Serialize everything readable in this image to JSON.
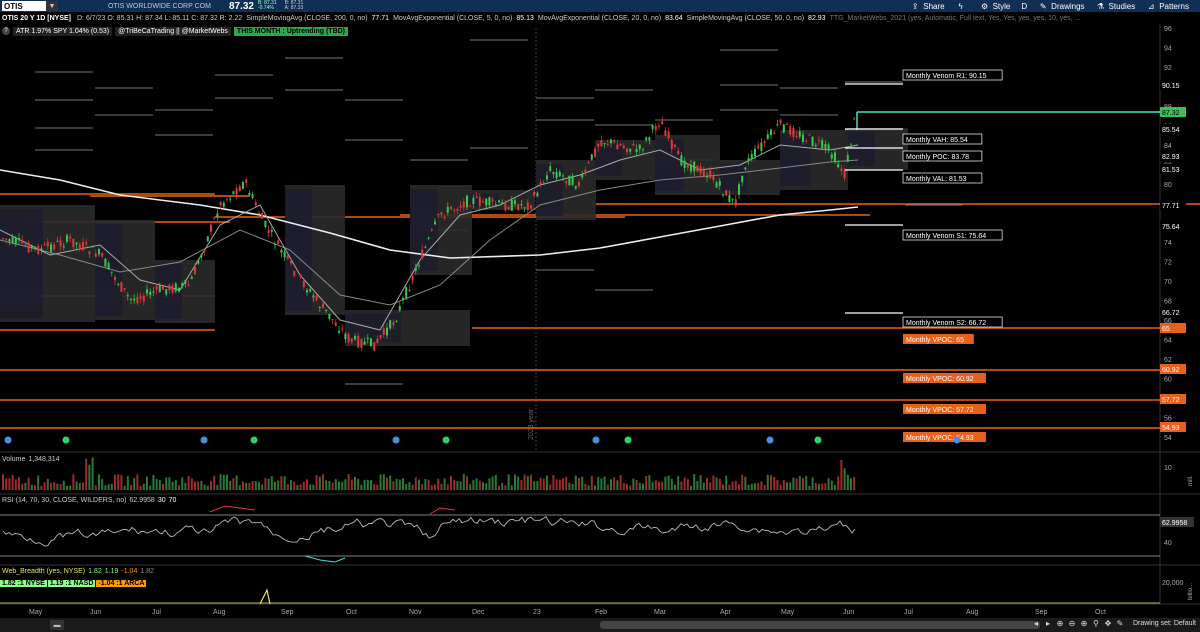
{
  "topbar": {
    "symbol": "OTIS",
    "company": "OTIS WORLDWIDE CORP COM",
    "last": "87.32",
    "bid_top": "B: 87.31",
    "bid_bot": "-0.74%",
    "ask_top": "B: 87.31",
    "ask_bot": "A: 87.33",
    "buttons": [
      {
        "label": "Share",
        "icon": "share-icon"
      },
      {
        "label": "",
        "icon": "lightning-icon"
      },
      {
        "label": "Style",
        "icon": "style-icon"
      },
      {
        "label": "D",
        "icon": "period-icon"
      },
      {
        "label": "Drawings",
        "icon": "drawings-icon"
      },
      {
        "label": "Studies",
        "icon": "flask-icon"
      },
      {
        "label": "Patterns",
        "icon": "patterns-icon"
      }
    ]
  },
  "studybar": {
    "symbol": "OTIS 20 Y 1D [NYSE]",
    "ohlc": "D: 6/7/23   O: 85.31   H: 87.34   L: 85.11   C: 87.32   R: 2.22",
    "sma200": "SimpleMovingAvg (CLOSE, 200, 0, no)",
    "sma200_val": "77.71",
    "ema5": "MovAvgExponential (CLOSE, 5, 0, no)",
    "ema5_val": "85.13",
    "ema20": "MovAvgExponential (CLOSE, 20, 0, no)",
    "ema20_val": "83.64",
    "sma50": "SimpleMovingAvg (CLOSE, 50, 0, no)",
    "sma50_val": "82.93",
    "ttg": "TTG_MarketWebs_2021 (yes, Automatic, Full text, Yes, Yes, yes, yes, 10, yes, ..."
  },
  "row2": {
    "atr": "ATR 1.97% SPY 1.04% (0.53)",
    "handles": "@TriBeCaTrading || @MarketWebs",
    "status": "THIS MONTH : Uptrending (TBD)"
  },
  "price_axis": [
    "96",
    "94",
    "92",
    "90",
    "88",
    "86",
    "84",
    "82",
    "80",
    "78",
    "76",
    "74",
    "72",
    "70",
    "68",
    "66",
    "64",
    "62",
    "60",
    "58",
    "56",
    "54"
  ],
  "price_labels": [
    {
      "text": "90.15",
      "color": "#ffffff",
      "bg": "#000000"
    },
    {
      "text": "87.32",
      "color": "#000000",
      "bg": "#3fbf5a"
    },
    {
      "text": "85.54",
      "color": "#ffffff",
      "bg": "#000000"
    },
    {
      "text": "82.93",
      "color": "#ffffff",
      "bg": "#000000"
    },
    {
      "text": "81.53",
      "color": "#ffffff",
      "bg": "#000000"
    },
    {
      "text": "77.71",
      "color": "#ffffff",
      "bg": "#000000"
    },
    {
      "text": "75.64",
      "color": "#ffffff",
      "bg": "#000000"
    },
    {
      "text": "66.72",
      "color": "#ffffff",
      "bg": "#000000"
    },
    {
      "text": "65",
      "color": "#ffffff",
      "bg": "#e8601a"
    },
    {
      "text": "60.92",
      "color": "#ffffff",
      "bg": "#e8601a"
    },
    {
      "text": "57.72",
      "color": "#ffffff",
      "bg": "#e8601a"
    },
    {
      "text": "54.93",
      "color": "#ffffff",
      "bg": "#e8601a"
    }
  ],
  "annotations": [
    {
      "text": "Monthly Venom R1: 90.15"
    },
    {
      "text": "Monthly VAH: 85.54"
    },
    {
      "text": "Monthly POC: 83.78"
    },
    {
      "text": "Monthly VAL: 81.53"
    },
    {
      "text": "Monthly Venom S1: 75.64"
    },
    {
      "text": "Monthly Venom S2: 66.72"
    },
    {
      "text": "Monthly VPOC: 65"
    },
    {
      "text": "Monthly VPOC: 60.92"
    },
    {
      "text": "Monthly VPOC: 57.72"
    },
    {
      "text": "Monthly VPOC: 54.93"
    }
  ],
  "year_marker": "2023 year",
  "volume": {
    "title": "Volume",
    "value": "1,348,314",
    "axis_top": "10",
    "axis_unit": "mill."
  },
  "rsi": {
    "title": "RSI (14, 70, 30, CLOSE, WILDERS, no)",
    "value": "62.9958",
    "ob": "30",
    "os": "70",
    "axis": [
      "60",
      "40"
    ],
    "label": "62.9958"
  },
  "breadth": {
    "title": "Web_Breadth (yes, NYSE)",
    "vals": [
      "1.82",
      "1.19",
      "-1.04",
      "1.82"
    ],
    "nyse": "1.82 :1 NYSE",
    "nasd": "1.19 :1 NASD",
    "arca": "-1.04 :1 ARCA",
    "axis_top": "20,000",
    "axis_unit": "billio..."
  },
  "months": [
    "May",
    "Jun",
    "Jul",
    "Aug",
    "Sep",
    "Oct",
    "Nov",
    "Dec",
    "23",
    "Feb",
    "Mar",
    "Apr",
    "May",
    "Jun",
    "Jul",
    "Aug",
    "Sep",
    "Oct"
  ],
  "bottom": {
    "drawing_set": "Drawing set: Default"
  },
  "colors": {
    "up": "#3cc84c",
    "down": "#e0393b",
    "orange": "#e8601a",
    "cyan": "#40e0d0"
  }
}
